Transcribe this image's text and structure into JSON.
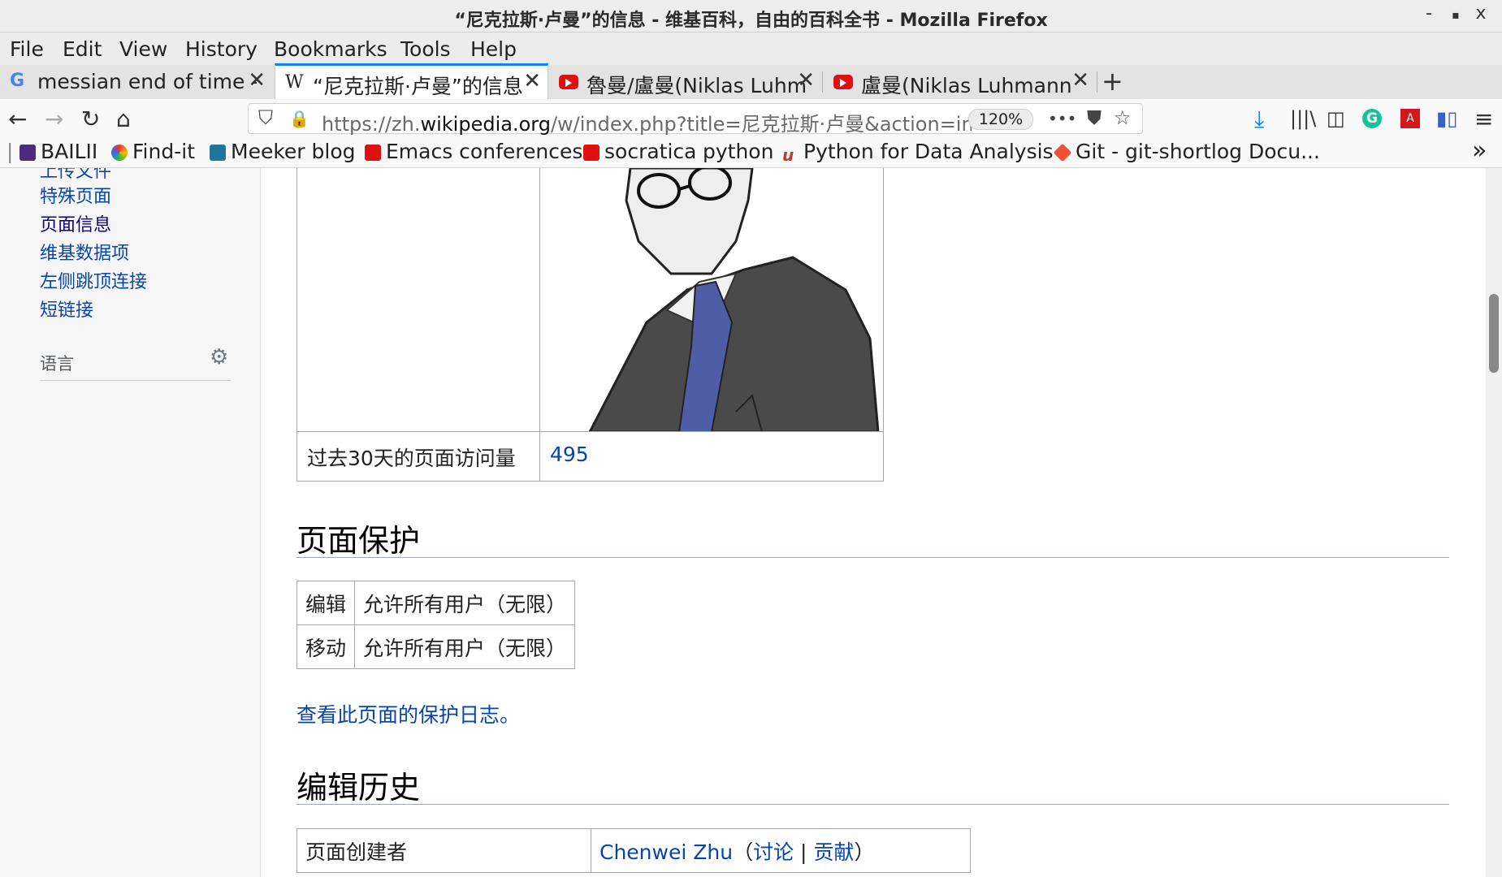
{
  "window": {
    "title": "“尼克拉斯·卢曼”的信息 - 维基百科，自由的百科全书 - Mozilla Firefox",
    "min": "-",
    "max": "▪",
    "close": "x"
  },
  "menu": [
    "File",
    "Edit",
    "View",
    "History",
    "Bookmarks",
    "Tools",
    "Help"
  ],
  "tabs": [
    {
      "label": "messian end of time -",
      "close": "✕"
    },
    {
      "label": "“尼克拉斯·卢曼”的信息",
      "close": "✕"
    },
    {
      "label": "魯曼/盧曼(Niklas Luhm",
      "close": "✕"
    },
    {
      "label": "盧曼(Niklas Luhmann",
      "close": "✕"
    }
  ],
  "newtab": "+",
  "url": {
    "prefix": "https://zh.",
    "domain": "wikipedia.org",
    "path": "/w/index.php?title=尼克拉斯·卢曼&action=info",
    "zoom": "120%"
  },
  "bookmarks": [
    "BAILII",
    "Find-it",
    "Meeker blog",
    "Emacs conferences",
    "socratica",
    "python",
    "Python for Data Analysis",
    "Git - git-shortlog Docu..."
  ],
  "bookmarks_more": "»",
  "sidebar": {
    "links": [
      "上传文件",
      "特殊页面",
      "页面信息",
      "维基数据项",
      "左侧跳顶连接",
      "短链接"
    ],
    "lang_heading": "语言"
  },
  "pageviews": {
    "label": "过去30天的页面访问量",
    "value": "495"
  },
  "protection": {
    "heading": "页面保护",
    "rows": [
      {
        "action": "编辑",
        "level": "允许所有用户（无限）"
      },
      {
        "action": "移动",
        "level": "允许所有用户（无限）"
      }
    ],
    "log_link": "查看此页面的保护日志。"
  },
  "history": {
    "heading": "编辑历史",
    "creator_label": "页面创建者",
    "creator": "Chenwei Zhu",
    "talk": "讨论",
    "contribs": "贡献",
    "open_paren": "（",
    "sep": "|",
    "close_paren": "）"
  }
}
